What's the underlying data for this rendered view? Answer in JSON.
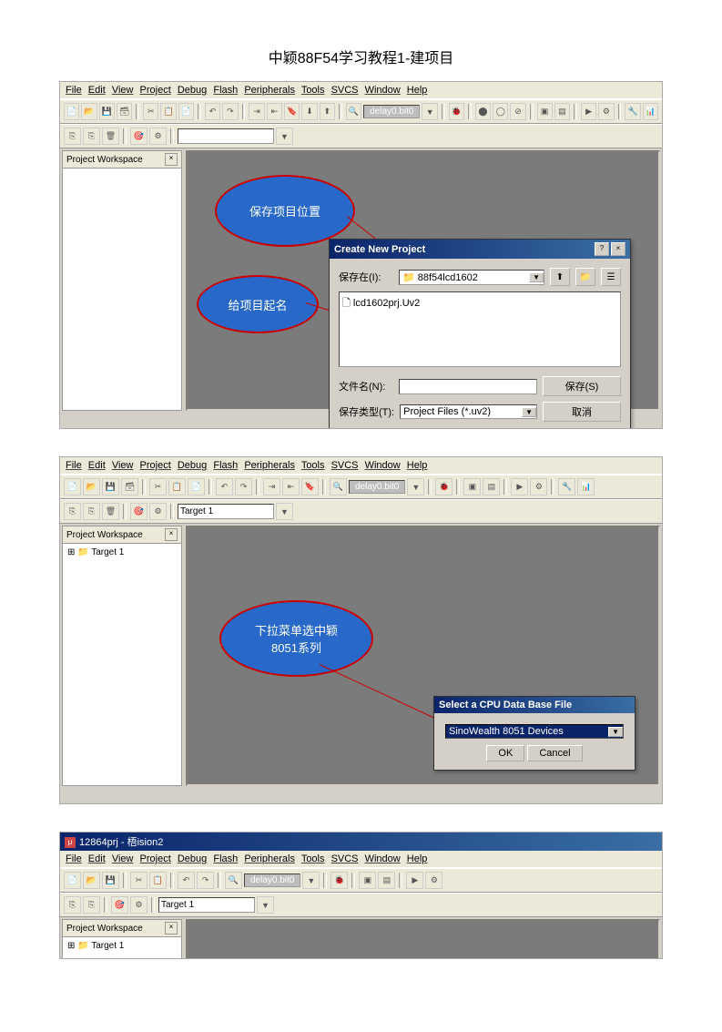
{
  "page_title": "中颖88F54学习教程1-建项目",
  "menu": [
    "File",
    "Edit",
    "View",
    "Project",
    "Debug",
    "Flash",
    "Peripherals",
    "Tools",
    "SVCS",
    "Window",
    "Help"
  ],
  "toolbar_field": "delay0.bit0",
  "workspace_title": "Project Workspace",
  "shot1": {
    "bubble1": "保存项目位置",
    "bubble2": "给项目起名",
    "dialog_title": "Create New Project",
    "save_in_label": "保存在(I):",
    "save_in_value": "88f54lcd1602",
    "file_item": "lcd1602prj.Uv2",
    "filename_label": "文件名(N):",
    "filename_value": "",
    "filetype_label": "保存类型(T):",
    "filetype_value": "Project Files (*.uv2)",
    "save_btn": "保存(S)",
    "cancel_btn": "取消"
  },
  "shot2": {
    "target_input": "Target 1",
    "tree_item": "Target 1",
    "bubble": "下拉菜单选中颖\n8051系列",
    "dialog_title": "Select a CPU Data Base File",
    "combo_value": "SinoWealth 8051 Devices",
    "ok_btn": "OK",
    "cancel_btn": "Cancel"
  },
  "shot3": {
    "titlebar": "12864prj - 梧ision2",
    "target_input": "Target 1",
    "tree_item": "Target 1"
  }
}
